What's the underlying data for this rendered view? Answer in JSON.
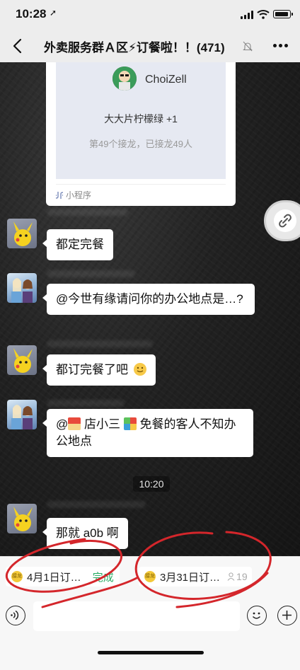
{
  "status_bar": {
    "time": "10:28",
    "location_glyph": "➚"
  },
  "nav": {
    "title": "外卖服务群Ａ区⚡订餐啦！！(471)"
  },
  "card": {
    "name": "ChoiZell",
    "line1": "大大片柠檬绿 +1",
    "line2": "第49个接龙，已接龙49人",
    "footer": "小程序"
  },
  "messages": [
    {
      "avatar": "pikachu",
      "text": "都定完餐"
    },
    {
      "avatar": "frozen",
      "text": "@今世有缘请问你的办公地点是…?"
    },
    {
      "avatar": "pikachu",
      "text": "都订完餐了吧"
    },
    {
      "avatar": "frozen",
      "text_a": "@",
      "text_b": " 店小三 ",
      "text_c": " 免餐的客人不知办公地点"
    },
    {
      "avatar": "pikachu",
      "text": "那就 a0b 啊"
    }
  ],
  "timestamp": "10:20",
  "quick_bar": {
    "chip1": {
      "badge": "接龙",
      "label": "4月1日订…",
      "status": "完成"
    },
    "chip2": {
      "badge": "接龙",
      "label": "3月31日订…",
      "count": "19"
    }
  },
  "colors": {
    "done_green": "#2aae67",
    "scribble_red": "#d4262b",
    "chat_bg": "#1c1c1c"
  },
  "icons": [
    "back-icon",
    "mute-bell-icon",
    "more-icon",
    "link-icon",
    "voice-icon",
    "emoji-icon",
    "plus-icon",
    "miniprogram-icon"
  ]
}
